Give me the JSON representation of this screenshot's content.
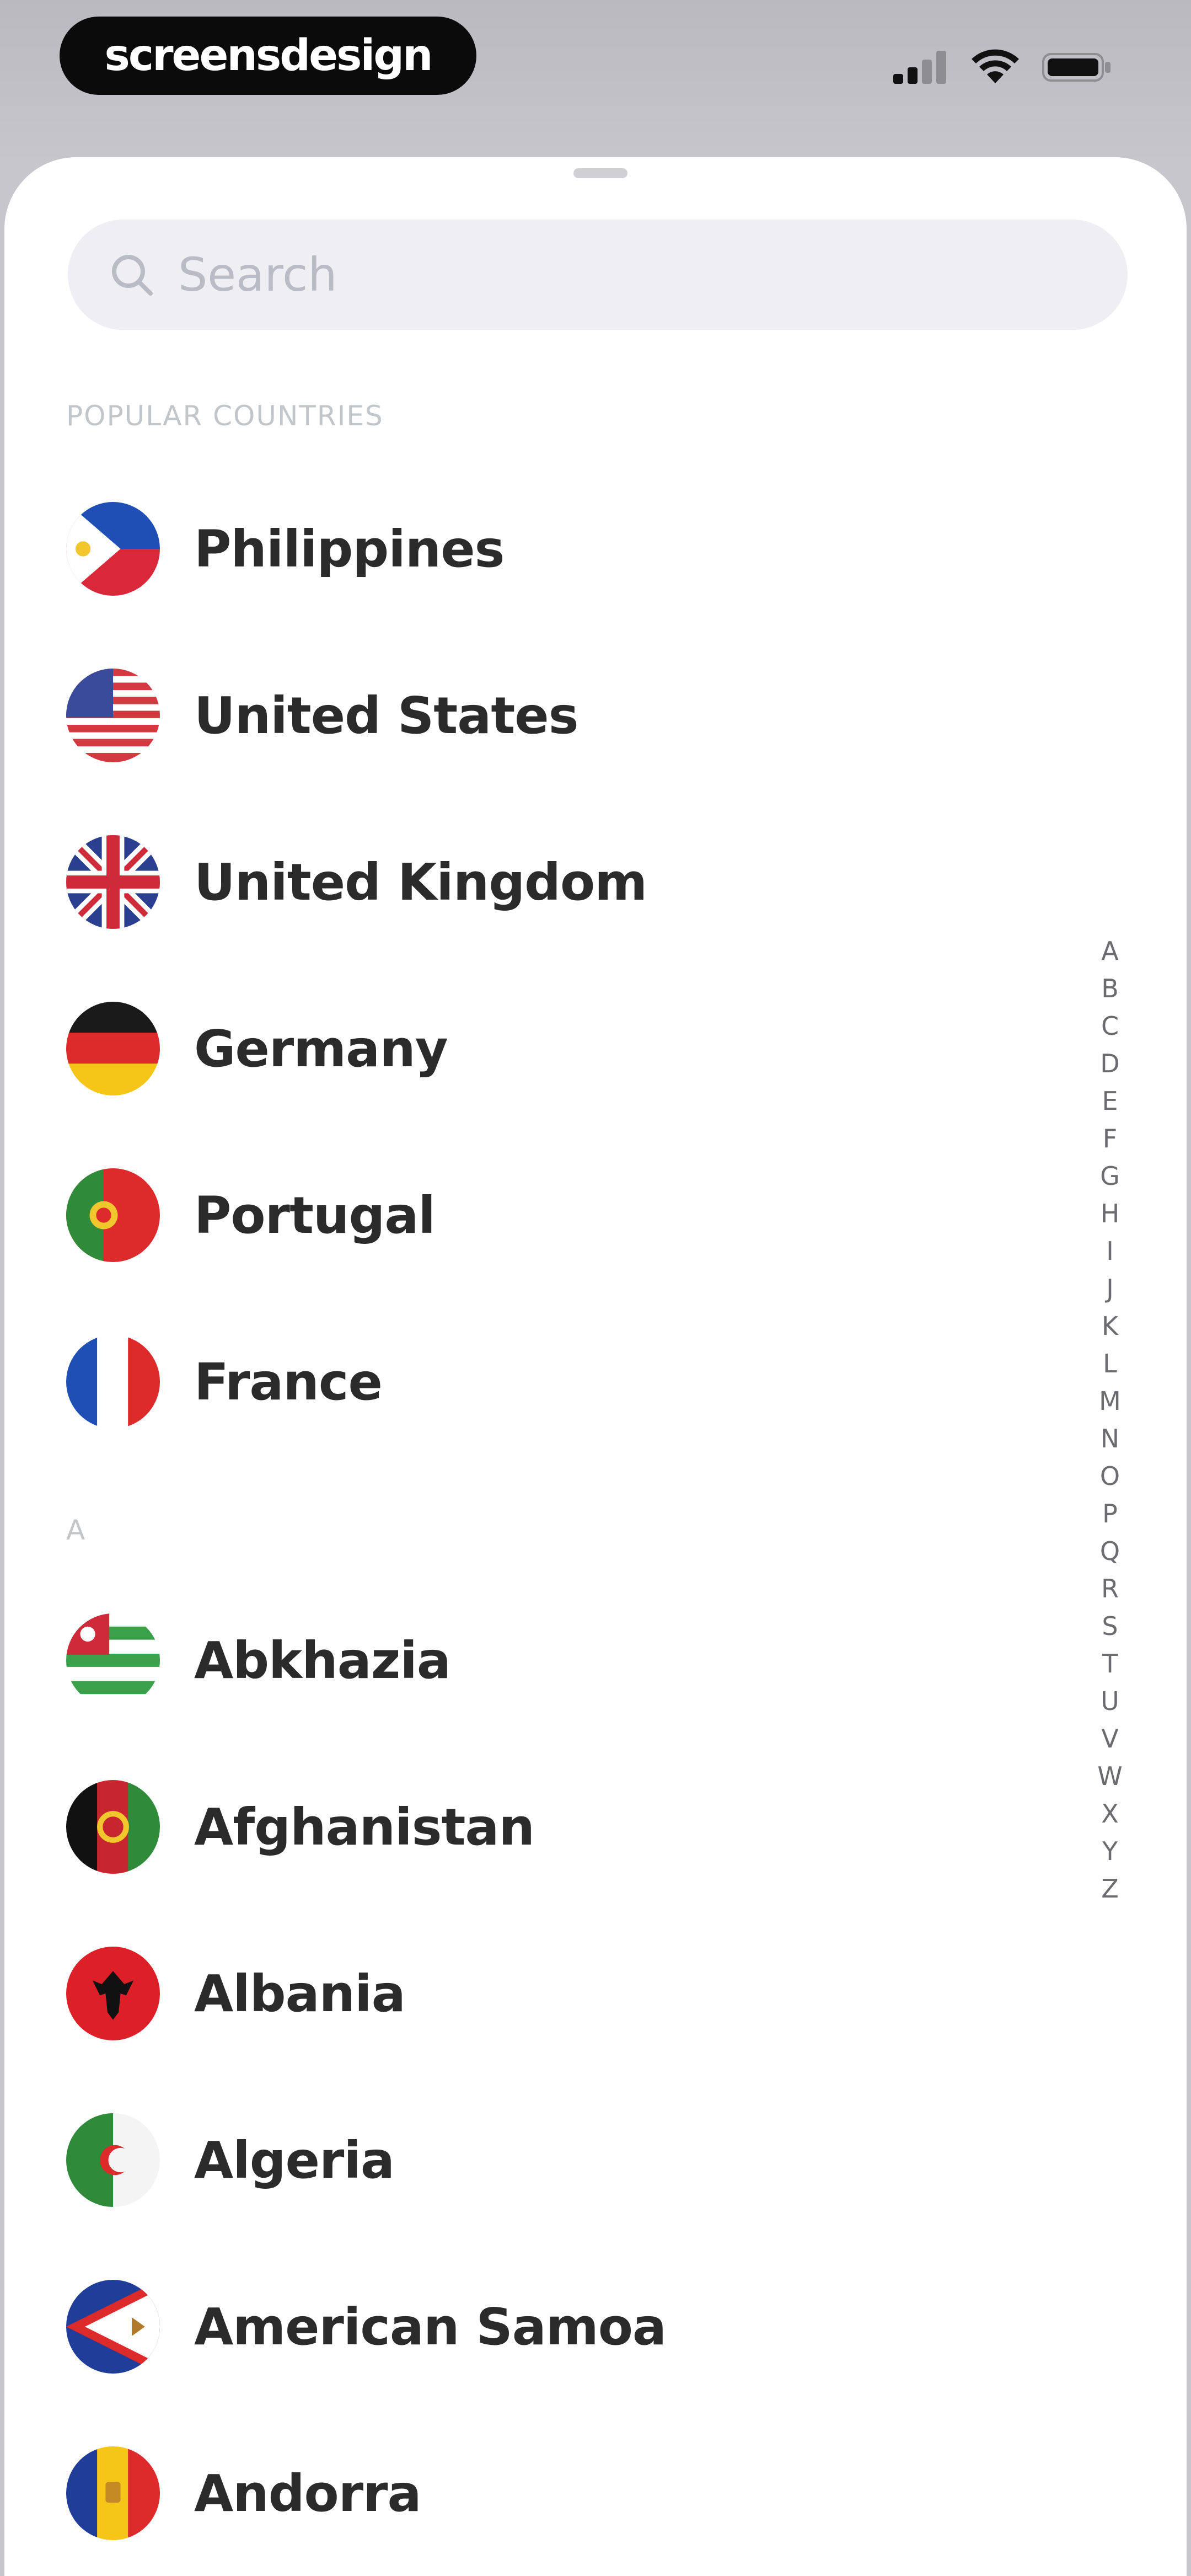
{
  "status_bar": {
    "brand": "screensdesign",
    "icons": [
      "cellular-signal-icon",
      "wifi-icon",
      "battery-icon"
    ]
  },
  "search": {
    "placeholder": "Search",
    "value": ""
  },
  "popular": {
    "header": "POPULAR COUNTRIES",
    "countries": [
      {
        "name": "Philippines",
        "flag": "flag-philippines"
      },
      {
        "name": "United States",
        "flag": "flag-united-states"
      },
      {
        "name": "United Kingdom",
        "flag": "flag-united-kingdom"
      },
      {
        "name": "Germany",
        "flag": "flag-germany"
      },
      {
        "name": "Portugal",
        "flag": "flag-portugal"
      },
      {
        "name": "France",
        "flag": "flag-france"
      }
    ]
  },
  "section_a": {
    "header": "A",
    "countries": [
      {
        "name": "Abkhazia",
        "flag": "flag-abkhazia"
      },
      {
        "name": "Afghanistan",
        "flag": "flag-afghanistan"
      },
      {
        "name": "Albania",
        "flag": "flag-albania"
      },
      {
        "name": "Algeria",
        "flag": "flag-algeria"
      },
      {
        "name": "American Samoa",
        "flag": "flag-american-samoa"
      },
      {
        "name": "Andorra",
        "flag": "flag-andorra"
      }
    ]
  },
  "alphabet_index": [
    "A",
    "B",
    "C",
    "D",
    "E",
    "F",
    "G",
    "H",
    "I",
    "J",
    "K",
    "L",
    "M",
    "N",
    "O",
    "P",
    "Q",
    "R",
    "S",
    "T",
    "U",
    "V",
    "W",
    "X",
    "Y",
    "Z"
  ],
  "colors": {
    "sheet_background": "#ffffff",
    "search_background": "#efeff3",
    "text_primary": "#2b2b2b",
    "section_header": "#c3c6c9"
  }
}
